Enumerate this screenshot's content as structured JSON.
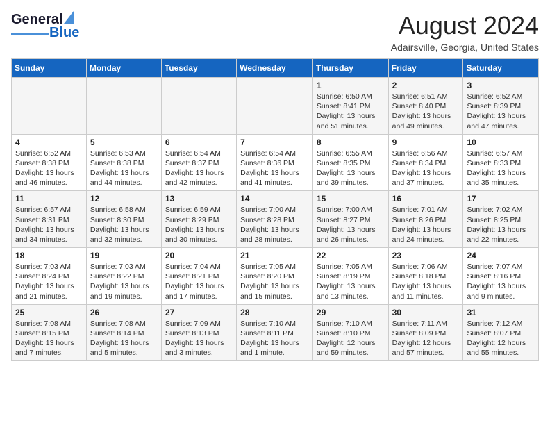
{
  "header": {
    "logo_general": "General",
    "logo_blue": "Blue",
    "month_title": "August 2024",
    "location": "Adairsville, Georgia, United States"
  },
  "calendar": {
    "days_of_week": [
      "Sunday",
      "Monday",
      "Tuesday",
      "Wednesday",
      "Thursday",
      "Friday",
      "Saturday"
    ],
    "weeks": [
      [
        {
          "day": "",
          "text": ""
        },
        {
          "day": "",
          "text": ""
        },
        {
          "day": "",
          "text": ""
        },
        {
          "day": "",
          "text": ""
        },
        {
          "day": "1",
          "text": "Sunrise: 6:50 AM\nSunset: 8:41 PM\nDaylight: 13 hours\nand 51 minutes."
        },
        {
          "day": "2",
          "text": "Sunrise: 6:51 AM\nSunset: 8:40 PM\nDaylight: 13 hours\nand 49 minutes."
        },
        {
          "day": "3",
          "text": "Sunrise: 6:52 AM\nSunset: 8:39 PM\nDaylight: 13 hours\nand 47 minutes."
        }
      ],
      [
        {
          "day": "4",
          "text": "Sunrise: 6:52 AM\nSunset: 8:38 PM\nDaylight: 13 hours\nand 46 minutes."
        },
        {
          "day": "5",
          "text": "Sunrise: 6:53 AM\nSunset: 8:38 PM\nDaylight: 13 hours\nand 44 minutes."
        },
        {
          "day": "6",
          "text": "Sunrise: 6:54 AM\nSunset: 8:37 PM\nDaylight: 13 hours\nand 42 minutes."
        },
        {
          "day": "7",
          "text": "Sunrise: 6:54 AM\nSunset: 8:36 PM\nDaylight: 13 hours\nand 41 minutes."
        },
        {
          "day": "8",
          "text": "Sunrise: 6:55 AM\nSunset: 8:35 PM\nDaylight: 13 hours\nand 39 minutes."
        },
        {
          "day": "9",
          "text": "Sunrise: 6:56 AM\nSunset: 8:34 PM\nDaylight: 13 hours\nand 37 minutes."
        },
        {
          "day": "10",
          "text": "Sunrise: 6:57 AM\nSunset: 8:33 PM\nDaylight: 13 hours\nand 35 minutes."
        }
      ],
      [
        {
          "day": "11",
          "text": "Sunrise: 6:57 AM\nSunset: 8:31 PM\nDaylight: 13 hours\nand 34 minutes."
        },
        {
          "day": "12",
          "text": "Sunrise: 6:58 AM\nSunset: 8:30 PM\nDaylight: 13 hours\nand 32 minutes."
        },
        {
          "day": "13",
          "text": "Sunrise: 6:59 AM\nSunset: 8:29 PM\nDaylight: 13 hours\nand 30 minutes."
        },
        {
          "day": "14",
          "text": "Sunrise: 7:00 AM\nSunset: 8:28 PM\nDaylight: 13 hours\nand 28 minutes."
        },
        {
          "day": "15",
          "text": "Sunrise: 7:00 AM\nSunset: 8:27 PM\nDaylight: 13 hours\nand 26 minutes."
        },
        {
          "day": "16",
          "text": "Sunrise: 7:01 AM\nSunset: 8:26 PM\nDaylight: 13 hours\nand 24 minutes."
        },
        {
          "day": "17",
          "text": "Sunrise: 7:02 AM\nSunset: 8:25 PM\nDaylight: 13 hours\nand 22 minutes."
        }
      ],
      [
        {
          "day": "18",
          "text": "Sunrise: 7:03 AM\nSunset: 8:24 PM\nDaylight: 13 hours\nand 21 minutes."
        },
        {
          "day": "19",
          "text": "Sunrise: 7:03 AM\nSunset: 8:22 PM\nDaylight: 13 hours\nand 19 minutes."
        },
        {
          "day": "20",
          "text": "Sunrise: 7:04 AM\nSunset: 8:21 PM\nDaylight: 13 hours\nand 17 minutes."
        },
        {
          "day": "21",
          "text": "Sunrise: 7:05 AM\nSunset: 8:20 PM\nDaylight: 13 hours\nand 15 minutes."
        },
        {
          "day": "22",
          "text": "Sunrise: 7:05 AM\nSunset: 8:19 PM\nDaylight: 13 hours\nand 13 minutes."
        },
        {
          "day": "23",
          "text": "Sunrise: 7:06 AM\nSunset: 8:18 PM\nDaylight: 13 hours\nand 11 minutes."
        },
        {
          "day": "24",
          "text": "Sunrise: 7:07 AM\nSunset: 8:16 PM\nDaylight: 13 hours\nand 9 minutes."
        }
      ],
      [
        {
          "day": "25",
          "text": "Sunrise: 7:08 AM\nSunset: 8:15 PM\nDaylight: 13 hours\nand 7 minutes."
        },
        {
          "day": "26",
          "text": "Sunrise: 7:08 AM\nSunset: 8:14 PM\nDaylight: 13 hours\nand 5 minutes."
        },
        {
          "day": "27",
          "text": "Sunrise: 7:09 AM\nSunset: 8:13 PM\nDaylight: 13 hours\nand 3 minutes."
        },
        {
          "day": "28",
          "text": "Sunrise: 7:10 AM\nSunset: 8:11 PM\nDaylight: 13 hours\nand 1 minute."
        },
        {
          "day": "29",
          "text": "Sunrise: 7:10 AM\nSunset: 8:10 PM\nDaylight: 12 hours\nand 59 minutes."
        },
        {
          "day": "30",
          "text": "Sunrise: 7:11 AM\nSunset: 8:09 PM\nDaylight: 12 hours\nand 57 minutes."
        },
        {
          "day": "31",
          "text": "Sunrise: 7:12 AM\nSunset: 8:07 PM\nDaylight: 12 hours\nand 55 minutes."
        }
      ]
    ]
  }
}
